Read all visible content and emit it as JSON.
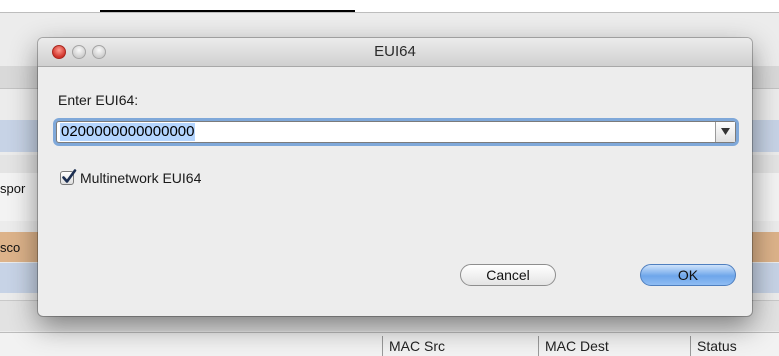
{
  "background": {
    "side_text_1": "spor",
    "side_text_2": "sco",
    "columns": [
      "MAC Src",
      "MAC Dest",
      "Status"
    ]
  },
  "dialog": {
    "title": "EUI64",
    "prompt": "Enter EUI64:",
    "eui64_value": "0200000000000000",
    "checkbox_label": "Multinetwork EUI64",
    "checkbox_checked": true,
    "cancel_label": "Cancel",
    "ok_label": "OK"
  },
  "colors": {
    "accent": "#6ea6ea",
    "focus_ring": "#7fa8d9",
    "selection": "#b4d5fe"
  },
  "icons": {
    "close": "close-icon",
    "minimize": "minimize-icon",
    "zoom": "zoom-icon",
    "dropdown": "chevron-down-icon",
    "check": "checkmark-icon"
  }
}
